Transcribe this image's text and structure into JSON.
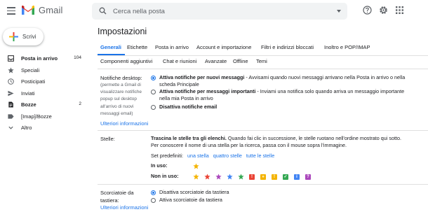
{
  "app": {
    "name": "Gmail"
  },
  "search": {
    "placeholder": "Cerca nella posta"
  },
  "compose": {
    "label": "Scrivi"
  },
  "sidebar": {
    "items": [
      {
        "label": "Posta in arrivo",
        "count": "104",
        "bold": true,
        "icon": "inbox-icon"
      },
      {
        "label": "Speciali",
        "count": "",
        "bold": false,
        "icon": "star-icon"
      },
      {
        "label": "Posticipati",
        "count": "",
        "bold": false,
        "icon": "clock-icon"
      },
      {
        "label": "Inviati",
        "count": "",
        "bold": false,
        "icon": "send-icon"
      },
      {
        "label": "Bozze",
        "count": "2",
        "bold": true,
        "icon": "draft-icon"
      },
      {
        "label": "[Imap]/Bozze",
        "count": "",
        "bold": false,
        "icon": "label-icon"
      },
      {
        "label": "Altro",
        "count": "",
        "bold": false,
        "icon": "chevron-down-icon"
      }
    ]
  },
  "settings": {
    "title": "Impostazioni",
    "tabs_row1": [
      "Generali",
      "Etichette",
      "Posta in arrivo",
      "Account e importazione",
      "Filtri e indirizzi bloccati",
      "Inoltro e POP/IMAP"
    ],
    "tabs_row2": [
      "Componenti aggiuntivi",
      "Chat e riunioni",
      "Avanzate",
      "Offline",
      "Temi"
    ],
    "active_tab": "Generali"
  },
  "notifications": {
    "label": "Notifiche desktop:",
    "note": [
      "(permette a Gmail di",
      "visualizzare notifiche",
      "popup sul desktop",
      "all'arrivo di nuovi",
      "messaggi email)"
    ],
    "more_link": "Ulteriori informazioni",
    "options": [
      {
        "bold": "Attiva notifiche per nuovi messaggi",
        "rest": " - Avvisami quando nuovi messaggi arrivano nella Posta in arrivo o nella",
        "line2": "scheda Principale",
        "selected": true
      },
      {
        "bold": "Attiva notifiche per messaggi importanti",
        "rest": " - Inviami una notifica solo quando arriva un messaggio importante",
        "line2": "nella mia Posta in arrivo",
        "selected": false
      },
      {
        "bold": "Disattiva notifiche email",
        "rest": "",
        "line2": "",
        "selected": false
      }
    ]
  },
  "stars": {
    "label": "Stelle:",
    "desc_bold": "Trascina le stelle tra gli elenchi.",
    "desc_rest": " Quando fai clic in successione, le stelle ruotano nell'ordine mostrato qui sotto.",
    "desc_line2": "Per conoscere il nome di una stella per la ricerca, passa con il mouse sopra l'immagine.",
    "presets_label": "Set predefiniti:",
    "presets": [
      "una stella",
      "quattro stelle",
      "tutte le stelle"
    ],
    "in_use_label": "In uso:",
    "not_in_use_label": "Non in uso:",
    "in_use": [
      {
        "type": "star",
        "color": "#f4b400"
      }
    ],
    "not_in_use": [
      {
        "type": "star",
        "color": "#f4b400"
      },
      {
        "type": "star",
        "color": "#ea4335"
      },
      {
        "type": "star",
        "color": "#ab47bc"
      },
      {
        "type": "star",
        "color": "#4285f4"
      },
      {
        "type": "star",
        "color": "#34a853"
      },
      {
        "type": "square",
        "color": "#ea4335",
        "glyph": "!"
      },
      {
        "type": "square",
        "color": "#f4b400",
        "glyph": "»"
      },
      {
        "type": "square",
        "color": "#f4b400",
        "glyph": "!"
      },
      {
        "type": "square",
        "color": "#34a853",
        "glyph": "✓"
      },
      {
        "type": "square",
        "color": "#4285f4",
        "glyph": "i"
      },
      {
        "type": "square",
        "color": "#ab47bc",
        "glyph": "?"
      }
    ]
  },
  "shortcuts": {
    "label": "Scorciatoie da",
    "label2": "tastiera:",
    "more_link": "Ulteriori informazioni",
    "options": [
      {
        "label": "Disattiva scorciatoie da tastiera",
        "selected": true
      },
      {
        "label": "Attiva scorciatoie da tastiera",
        "selected": false
      }
    ]
  }
}
